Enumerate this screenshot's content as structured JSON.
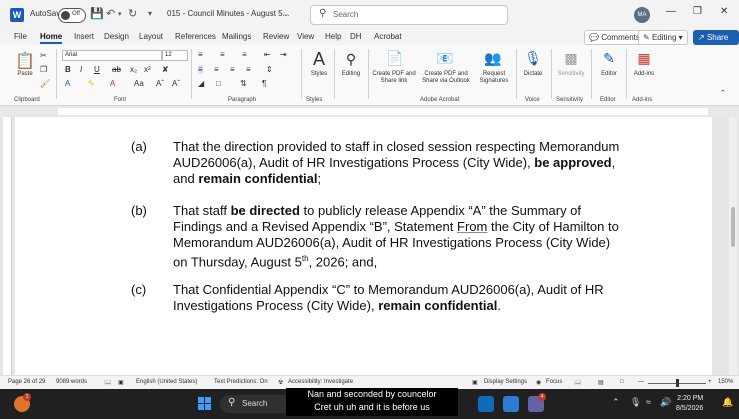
{
  "titlebar": {
    "autosave_label": "AutoSave",
    "autosave_state": "Off",
    "doc_title": "015 - Council Minutes - August 5...",
    "search_placeholder": "Search",
    "avatar_initials": "MA"
  },
  "menu_tabs": [
    "File",
    "Home",
    "Insert",
    "Design",
    "Layout",
    "References",
    "Mailings",
    "Review",
    "View",
    "Help",
    "DH",
    "Acrobat"
  ],
  "active_tab": "Home",
  "top_right": {
    "comments": "Comments",
    "editing": "Editing",
    "share": "Share"
  },
  "ribbon": {
    "clipboard": {
      "paste": "Paste",
      "label": "Clipboard"
    },
    "font": {
      "name": "Arial",
      "size": "12",
      "label": "Font"
    },
    "paragraph": {
      "label": "Paragraph"
    },
    "styles": {
      "btn": "Styles",
      "label": "Styles"
    },
    "editing": {
      "btn": "Editing"
    },
    "acrobat": {
      "b1": "Create PDF and Share link",
      "b2": "Create PDF and Share via Outlook",
      "b3": "Request Signatures",
      "label": "Adobe Acrobat"
    },
    "voice": {
      "btn": "Dictate",
      "label": "Voice"
    },
    "sensitivity": {
      "btn": "Sensitivity",
      "label": "Sensitivity"
    },
    "editor": {
      "btn": "Editor",
      "label": "Editor"
    },
    "addins": {
      "btn": "Add-ins",
      "label": "Add-ins"
    }
  },
  "document": {
    "paragraphs": [
      {
        "label": "(a)",
        "lines": [
          [
            {
              "t": "That the direction provided to staff in closed session respecting Memorandum"
            }
          ],
          [
            {
              "t": "AUD26006(a), Audit of HR Investigations Process (City Wide), "
            },
            {
              "t": "be approved",
              "b": true
            },
            {
              "t": ","
            }
          ],
          [
            {
              "t": "and "
            },
            {
              "t": "remain confidential",
              "b": true
            },
            {
              "t": ";"
            }
          ]
        ]
      },
      {
        "label": "(b)",
        "lines": [
          [
            {
              "t": "That staff "
            },
            {
              "t": "be directed",
              "b": true
            },
            {
              "t": " to publicly release Appendix “A” the Summary of"
            }
          ],
          [
            {
              "t": "Findings and a Revised Appendix “B”, Statement "
            },
            {
              "t": "From",
              "u": true
            },
            {
              "t": " the City of Hamilton to"
            }
          ],
          [
            {
              "t": "Memorandum AUD26006(a), Audit of HR Investigations Process (City Wide)"
            }
          ],
          [
            {
              "t": "on Thursday, August 5"
            },
            {
              "t": "th",
              "sup": true
            },
            {
              "t": ", 2026; and,"
            }
          ]
        ]
      },
      {
        "label": "(c)",
        "lines": [
          [
            {
              "t": "That Confidential Appendix “C” to Memorandum AUD26006(a), Audit of HR"
            }
          ],
          [
            {
              "t": "Investigations Process (City Wide), "
            },
            {
              "t": "remain confidential",
              "b": true
            },
            {
              "t": "."
            }
          ]
        ]
      }
    ]
  },
  "statusbar": {
    "page": "Page 26 of 29",
    "words": "9089 words",
    "language": "English (United States)",
    "predictions": "Text Predictions: On",
    "accessibility": "Accessibility: Investigate",
    "display": "Display Settings",
    "focus": "Focus",
    "zoom": "150%"
  },
  "taskbar": {
    "search": "Search",
    "time": "2:20 PM",
    "date": "8/5/2026",
    "weather_badge": "1",
    "teams_badge": "4"
  },
  "captions": {
    "line1": "Nan and seconded by councelor",
    "line2": "Cret uh uh and it is before us"
  }
}
